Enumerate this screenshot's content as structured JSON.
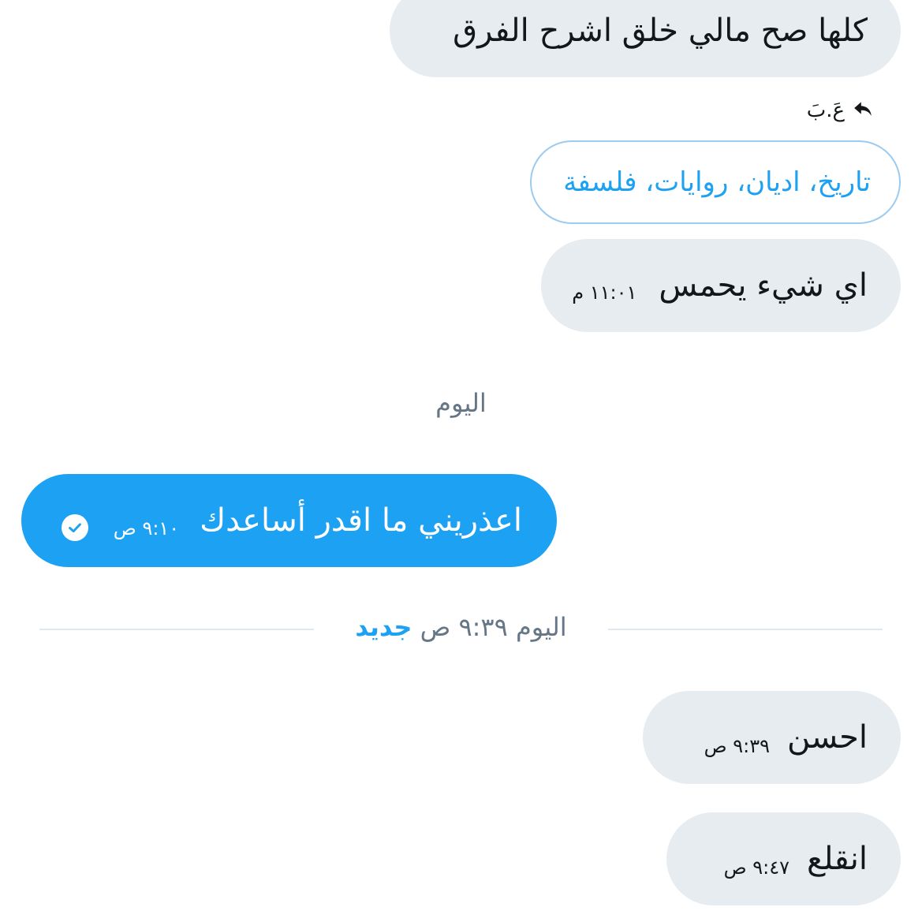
{
  "messages": [
    {
      "text": "كلها صح مالي خلق اشرح الفرق"
    },
    {
      "text": "اي شيء يحمس",
      "time": "١١:٠١ م"
    },
    {
      "text": "اعذريني ما اقدر أساعدك",
      "time": "٩:١٠ ص"
    },
    {
      "text": "احسن",
      "time": "٩:٣٩ ص"
    },
    {
      "text": "انقلع",
      "time": "٩:٤٧ ص"
    }
  ],
  "reply": {
    "name": "عَ.بَ",
    "quoted_text": "تاريخ، اديان، روايات، فلسفة"
  },
  "separators": {
    "day": "اليوم",
    "new_messages_prefix": "اليوم ٩:٣٩ ص",
    "new_messages_label": "جديد"
  },
  "colors": {
    "accent": "#1da1f2",
    "incoming_bubble": "#e6ecf0",
    "secondary_text": "#657786"
  },
  "icons": [
    "reply-arrow-icon",
    "check-circle-icon"
  ]
}
